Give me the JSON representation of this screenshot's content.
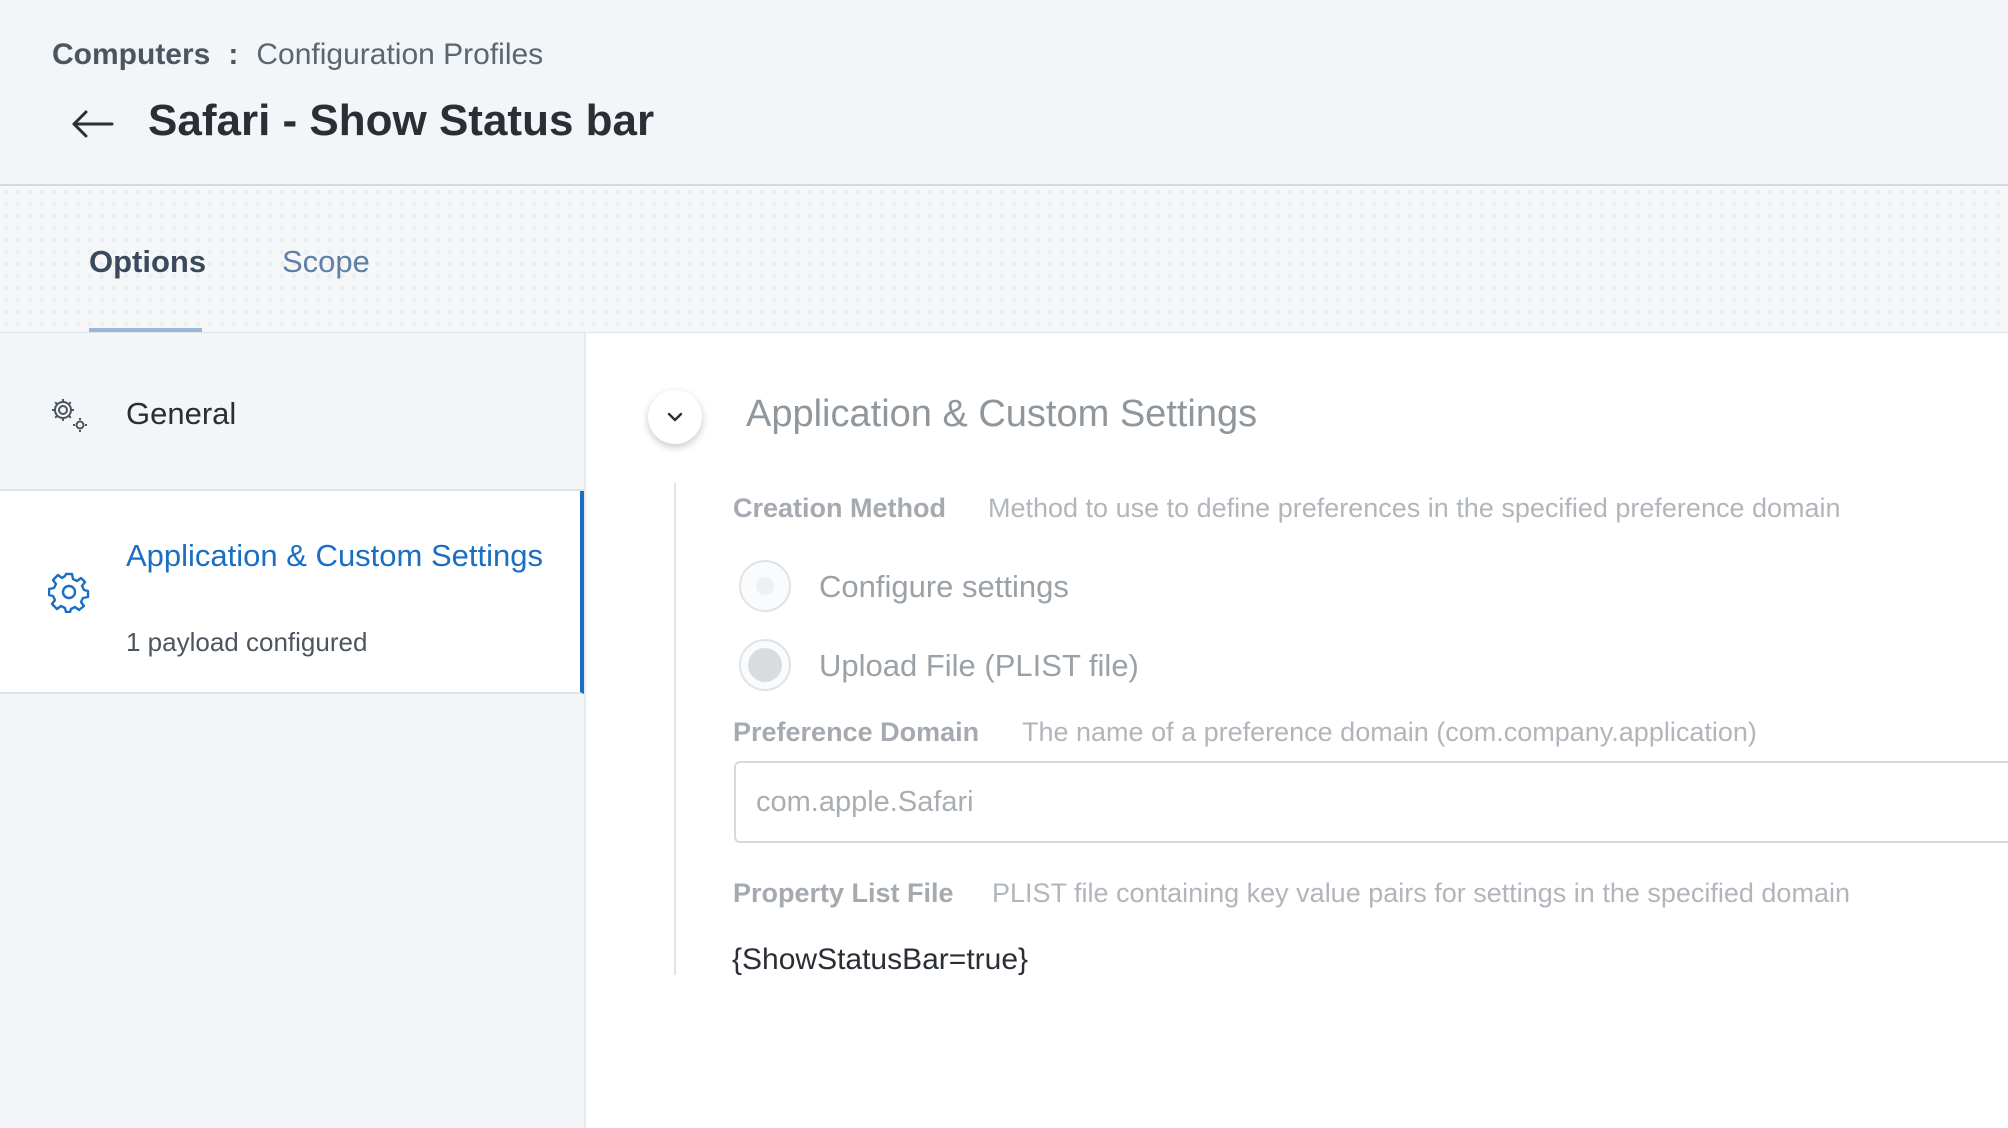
{
  "breadcrumb": {
    "root": "Computers",
    "separator": ":",
    "current": "Configuration Profiles"
  },
  "page": {
    "title": "Safari - Show Status bar"
  },
  "tabs": [
    {
      "label": "Options",
      "active": true
    },
    {
      "label": "Scope",
      "active": false
    }
  ],
  "sidebar": {
    "items": [
      {
        "label": "General",
        "icon": "gears-icon",
        "selected": false
      },
      {
        "label": "Application & Custom Settings",
        "sublabel": "1 payload configured",
        "icon": "gear-icon",
        "selected": true
      }
    ]
  },
  "section": {
    "title": "Application & Custom Settings",
    "creation_method": {
      "label": "Creation Method",
      "description": "Method to use to define preferences in the specified preference domain",
      "options": [
        {
          "label": "Configure settings",
          "selected": false
        },
        {
          "label": "Upload File (PLIST file)",
          "selected": true
        }
      ]
    },
    "preference_domain": {
      "label": "Preference Domain",
      "description": "The name of a preference domain (com.company.application)",
      "value": "com.apple.Safari"
    },
    "property_list": {
      "label": "Property List File",
      "description": "PLIST file containing key value pairs for settings in the specified domain",
      "value": "{ShowStatusBar=true}"
    }
  },
  "colors": {
    "accent": "#1a6fc4",
    "header_bg": "#f2f6f9",
    "muted_text": "#a4aab0"
  }
}
